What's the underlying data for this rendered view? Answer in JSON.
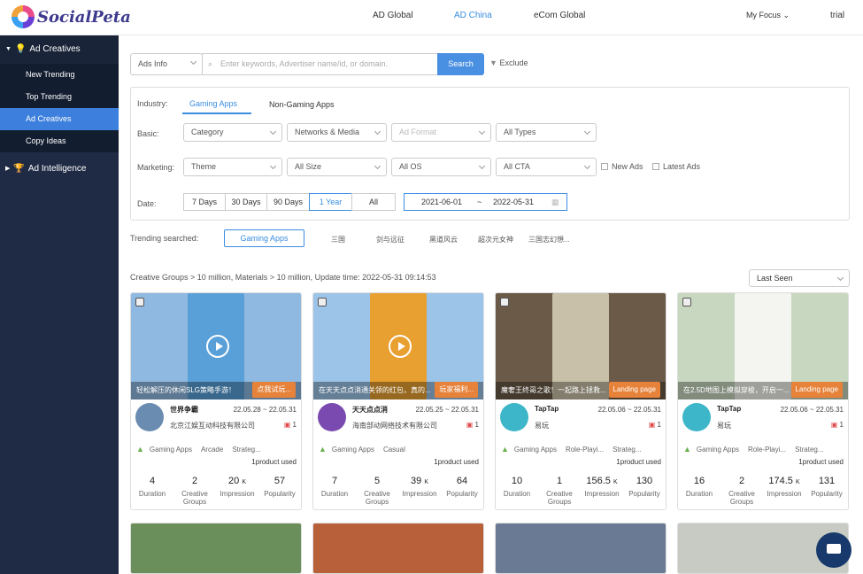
{
  "logo": {
    "text": "SocialPeta"
  },
  "topnav": {
    "items": [
      "AD Global",
      "AD China",
      "eCom Global"
    ],
    "active": 1,
    "my_focus": "My Focus",
    "user": "trial"
  },
  "sidebar": {
    "section1": "Ad Creatives",
    "items": [
      "New Trending",
      "Top Trending",
      "Ad Creatives",
      "Copy Ideas"
    ],
    "active": 2,
    "section2": "Ad Intelligence"
  },
  "search": {
    "type": "Ads Info",
    "placeholder": "Enter keywords, Advertiser name/id, or domain.",
    "button": "Search",
    "exclude": "Exclude"
  },
  "filters": {
    "industry_label": "Industry:",
    "industry_tabs": [
      "Gaming Apps",
      "Non-Gaming Apps"
    ],
    "basic_label": "Basic:",
    "basic": [
      "Category",
      "Networks & Media",
      "Ad Format",
      "All Types"
    ],
    "marketing_label": "Marketing:",
    "marketing": [
      "Theme",
      "All Size",
      "All OS",
      "All CTA"
    ],
    "checks": [
      "New Ads",
      "Latest Ads"
    ],
    "date_label": "Date:",
    "date_buttons": [
      "7 Days",
      "30 Days",
      "90 Days",
      "1 Year",
      "All"
    ],
    "date_active": 3,
    "date_from": "2021-06-01",
    "date_sep": "~",
    "date_to": "2022-05-31"
  },
  "trending": {
    "label": "Trending searched:",
    "items": [
      "Gaming Apps",
      "三国",
      "剑与远征",
      "黑道风云",
      "超次元女神",
      "三国志幻想..."
    ]
  },
  "summary": "Creative Groups > 10 million,  Materials > 10 million,   Update time:  2022-05-31 09:14:53",
  "sort": "Last Seen",
  "stat_labels": [
    "Duration",
    "Creative Groups",
    "Impression",
    "Popularity"
  ],
  "cards": [
    {
      "caption": "轻松解压的休闲SLG策略手游！",
      "tag": "点我试玩...",
      "name": "世界争霸",
      "dates": "22.05.28 ~ 22.05.31",
      "company": "北京江娱互动科技有限公司",
      "count": "1",
      "tags": [
        "Gaming Apps",
        "Arcade",
        "Strateg..."
      ],
      "product": "1product used",
      "stats": [
        "4",
        "2",
        "20",
        "57"
      ],
      "unit": "K",
      "bg": "#8fb9e0",
      "ph": "#5aa0d8",
      "av": "#6a8cb0"
    },
    {
      "caption": "在天天点点消通关领的红包，真的...",
      "tag": "玩家福利...",
      "name": "天天点点消",
      "dates": "22.05.25 ~ 22.05.31",
      "company": "海南部动网络技术有限公司",
      "count": "1",
      "tags": [
        "Gaming Apps",
        "Casual"
      ],
      "product": "1product used",
      "stats": [
        "7",
        "5",
        "39",
        "64"
      ],
      "unit": "K",
      "bg": "#9cc3e8",
      "ph": "#e8a030",
      "av": "#7a4ab0"
    },
    {
      "caption": "魔奢王终哥之歌！一起路上拯救...",
      "tag": "Landing page",
      "name": "TapTap",
      "dates": "22.05.06 ~ 22.05.31",
      "company": "易玩",
      "count": "1",
      "tags": [
        "Gaming Apps",
        "Role-Playi...",
        "Strateg..."
      ],
      "product": "1product used",
      "stats": [
        "10",
        "1",
        "156.5",
        "130"
      ],
      "unit": "K",
      "bg": "#6b5a48",
      "ph": "#c8c0a8",
      "av": "#3cb6c8"
    },
    {
      "caption": "在2.5D地图上模拟穿梭，开启一...",
      "tag": "Landing page",
      "name": "TapTap",
      "dates": "22.05.06 ~ 22.05.31",
      "company": "易玩",
      "count": "1",
      "tags": [
        "Gaming Apps",
        "Role-Playi...",
        "Strateg..."
      ],
      "product": "1product used",
      "stats": [
        "16",
        "2",
        "174.5",
        "131"
      ],
      "unit": "K",
      "bg": "#c8d8c0",
      "ph": "#f4f4f0",
      "av": "#3cb6c8"
    }
  ]
}
